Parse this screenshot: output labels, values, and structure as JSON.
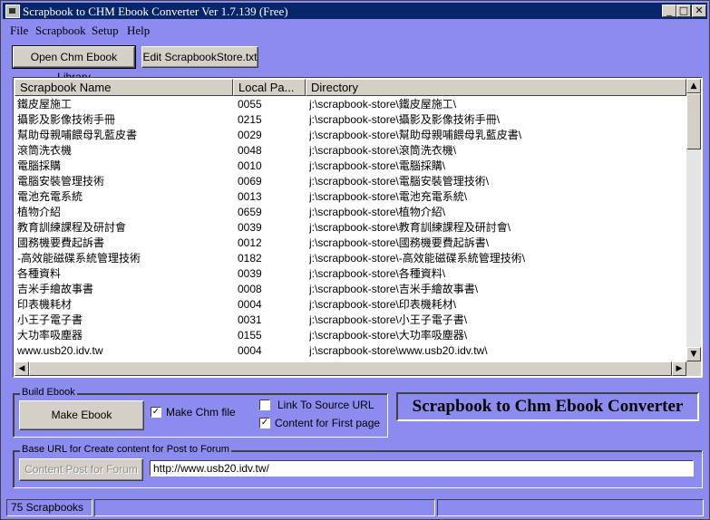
{
  "window": {
    "title": "Scrapbook to CHM Ebook Converter Ver 1.7.139 (Free)"
  },
  "menu": [
    "File",
    "Scrapbook",
    "Setup",
    "Help"
  ],
  "toolbar": {
    "open_library": "Open Chm Ebook Library",
    "edit_store": "Edit ScrapbookStore.txt"
  },
  "table": {
    "columns": [
      "Scrapbook Name",
      "Local Pa...",
      "Directory"
    ],
    "rows": [
      [
        "鐵皮屋施工",
        "0055",
        "j:\\scrapbook-store\\鐵皮屋施工\\"
      ],
      [
        "攝影及影像技術手冊",
        "0215",
        "j:\\scrapbook-store\\攝影及影像技術手冊\\"
      ],
      [
        "幫助母親哺餵母乳藍皮書",
        "0029",
        "j:\\scrapbook-store\\幫助母親哺餵母乳藍皮書\\"
      ],
      [
        "滾筒洗衣機",
        "0048",
        "j:\\scrapbook-store\\滾筒洗衣機\\"
      ],
      [
        "電腦採購",
        "0010",
        "j:\\scrapbook-store\\電腦採購\\"
      ],
      [
        "電腦安裝管理技術",
        "0069",
        "j:\\scrapbook-store\\電腦安裝管理技術\\"
      ],
      [
        "電池充電系統",
        "0013",
        "j:\\scrapbook-store\\電池充電系統\\"
      ],
      [
        "植物介紹",
        "0659",
        "j:\\scrapbook-store\\植物介紹\\"
      ],
      [
        "教育訓練課程及研討會",
        "0039",
        "j:\\scrapbook-store\\教育訓練課程及研討會\\"
      ],
      [
        "國務機要費起訴書",
        "0012",
        "j:\\scrapbook-store\\國務機要費起訴書\\"
      ],
      [
        "-高效能磁碟系統管理技術",
        "0182",
        "j:\\scrapbook-store\\-高效能磁碟系統管理技術\\"
      ],
      [
        "各種資料",
        "0039",
        "j:\\scrapbook-store\\各種資料\\"
      ],
      [
        "吉米手繪故事書",
        "0008",
        "j:\\scrapbook-store\\吉米手繪故事書\\"
      ],
      [
        "印表機耗材",
        "0004",
        "j:\\scrapbook-store\\印表機耗材\\"
      ],
      [
        "小王子電子書",
        "0031",
        "j:\\scrapbook-store\\小王子電子書\\"
      ],
      [
        "大功率吸塵器",
        "0155",
        "j:\\scrapbook-store\\大功率吸塵器\\"
      ],
      [
        "www.usb20.idv.tw",
        "0004",
        "j:\\scrapbook-store\\www.usb20.idv.tw\\"
      ]
    ]
  },
  "build": {
    "group_label": "Build Ebook",
    "make_ebook": "Make Ebook",
    "make_chm_label": "Make Chm file",
    "make_chm_checked": true,
    "link_source_label": "Link To Source URL",
    "link_source_checked": false,
    "content_first_label": "Content for First page",
    "content_first_checked": true,
    "banner": "Scrapbook to Chm Ebook Converter"
  },
  "forum": {
    "group_label": "Base URL for Create content for Post to Forum",
    "post_button": "Content Post for Forum",
    "url_value": "http://www.usb20.idv.tw/"
  },
  "status": {
    "count": "75 Scrapbooks"
  }
}
